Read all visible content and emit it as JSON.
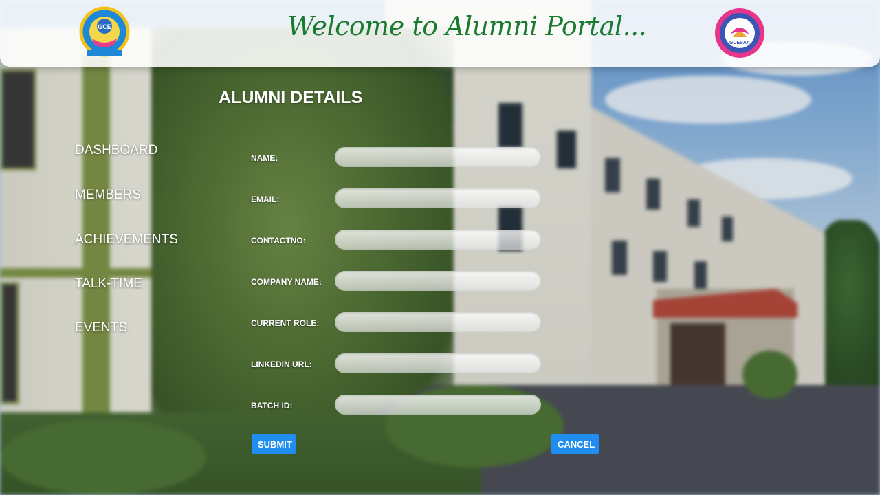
{
  "header": {
    "welcome_text": "Welcome to Alumni Portal...",
    "left_logo_icon": "college-emblem-logo",
    "right_logo_icon": "alumni-association-logo",
    "left_logo_text": "GCE",
    "right_logo_text": "GCESAA"
  },
  "sidebar": {
    "items": [
      {
        "label": "DASHBOARD"
      },
      {
        "label": "MEMBERS"
      },
      {
        "label": "ACHIEVEMENTS"
      },
      {
        "label": "TALK-TIME"
      },
      {
        "label": "EVENTS"
      }
    ]
  },
  "form": {
    "title": "ALUMNI DETAILS",
    "fields": [
      {
        "label": "NAME:",
        "value": ""
      },
      {
        "label": "EMAIL:",
        "value": ""
      },
      {
        "label": "CONTACTNO:",
        "value": ""
      },
      {
        "label": "COMPANY NAME:",
        "value": ""
      },
      {
        "label": "CURRENT ROLE:",
        "value": ""
      },
      {
        "label": "LINKEDIN URL:",
        "value": ""
      },
      {
        "label": "BATCH ID:",
        "value": ""
      }
    ],
    "submit_label": "SUBMIT",
    "cancel_label": "CANCEL"
  },
  "colors": {
    "accent_button": "#1f8ef0",
    "welcome_green": "#1a7a30",
    "header_bg": "#ffffff"
  }
}
